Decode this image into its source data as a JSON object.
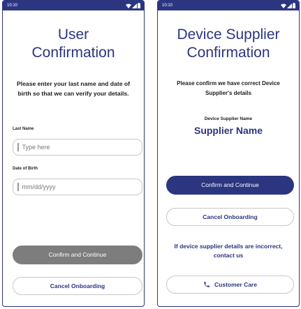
{
  "status_bar": {
    "time": "10:10"
  },
  "user_screen": {
    "title_line1": "User",
    "title_line2": "Confirmation",
    "instructions": {
      "part1": "Please enter your ",
      "bold1": "last name",
      "part2": " and ",
      "bold2": "date of birth",
      "part3": " so that we can verify your details."
    },
    "last_name": {
      "label": "Last Name",
      "placeholder": "Type here"
    },
    "dob": {
      "label": "Date of Birth",
      "placeholder": "mm/dd/yyyy"
    },
    "confirm_label": "Confirm and Continue",
    "cancel_label": "Cancel Onboarding"
  },
  "supplier_screen": {
    "title_line1": "Device Supplier",
    "title_line2": "Confirmation",
    "instructions": "Please confirm we have correct Device Supplier's details",
    "supplier_caption": "Device Supplier Name",
    "supplier_name": "Supplier Name",
    "confirm_label": "Confirm and Continue",
    "cancel_label": "Cancel Onboarding",
    "notice": "If device supplier details are incorrect, contact us",
    "customer_care_label": "Customer Care"
  },
  "colors": {
    "brand": "#2b3580",
    "disabled": "#7d7d7d",
    "border": "#c8c8c8"
  },
  "icons": {
    "wifi": "wifi-icon",
    "signal": "signal-icon",
    "battery": "battery-icon",
    "phone": "phone-icon"
  }
}
